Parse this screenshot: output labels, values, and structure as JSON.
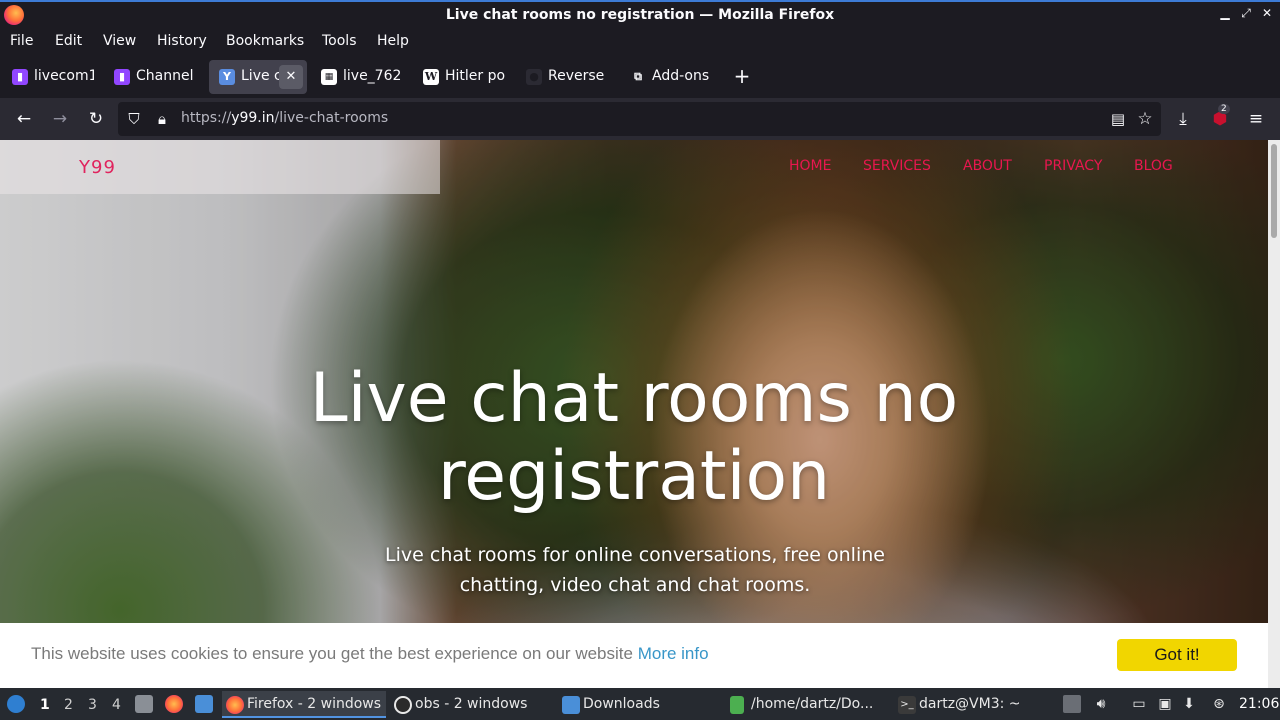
{
  "window": {
    "title": "Live chat rooms no registration — Mozilla Firefox"
  },
  "menu": [
    "File",
    "Edit",
    "View",
    "History",
    "Bookmarks",
    "Tools",
    "Help"
  ],
  "tabs": [
    {
      "label": "livecom1",
      "icon": "twitch-icon",
      "active": false
    },
    {
      "label": "Channel",
      "icon": "twitch-icon",
      "active": false
    },
    {
      "label": "Live c",
      "icon": "y99-icon",
      "active": true
    },
    {
      "label": "live_762",
      "icon": "qr-icon",
      "active": false
    },
    {
      "label": "Hitler po",
      "icon": "wikipedia-icon",
      "active": false
    },
    {
      "label": "Reverse",
      "icon": "spy-icon",
      "active": false
    },
    {
      "label": "Add-ons",
      "icon": "puzzle-icon",
      "active": false
    }
  ],
  "url": {
    "prefix": "https://",
    "host": "y99.in",
    "path": "/live-chat-rooms"
  },
  "extension_badge": "2",
  "site": {
    "logo": "Y99",
    "nav": [
      "HOME",
      "SERVICES",
      "ABOUT",
      "PRIVACY",
      "BLOG"
    ],
    "hero_title_line1": "Live chat rooms no",
    "hero_title_line2": "registration",
    "hero_sub_line1": "Live chat rooms for online conversations, free online",
    "hero_sub_line2": "chatting, video chat and chat rooms."
  },
  "cookie": {
    "text": "This website uses cookies to ensure you get the best experience on our website",
    "more": "More info",
    "button": "Got it!"
  },
  "taskbar": {
    "workspaces": [
      "1",
      "2",
      "3",
      "4"
    ],
    "tasks": [
      {
        "label": "Firefox - 2 windows",
        "icon": "firefox-icon",
        "active": true
      },
      {
        "label": "obs - 2 windows",
        "icon": "obs-icon",
        "active": false
      },
      {
        "label": "Downloads",
        "icon": "folder-icon",
        "active": false
      },
      {
        "label": "/home/dartz/Do...",
        "icon": "text-editor-icon",
        "active": false
      },
      {
        "label": "dartz@VM3: ~",
        "icon": "terminal-icon",
        "active": false
      }
    ],
    "clock": "21:06"
  },
  "colors": {
    "accent": "#e8174f",
    "cookie_button": "#f1d600",
    "link": "#3896c8"
  }
}
